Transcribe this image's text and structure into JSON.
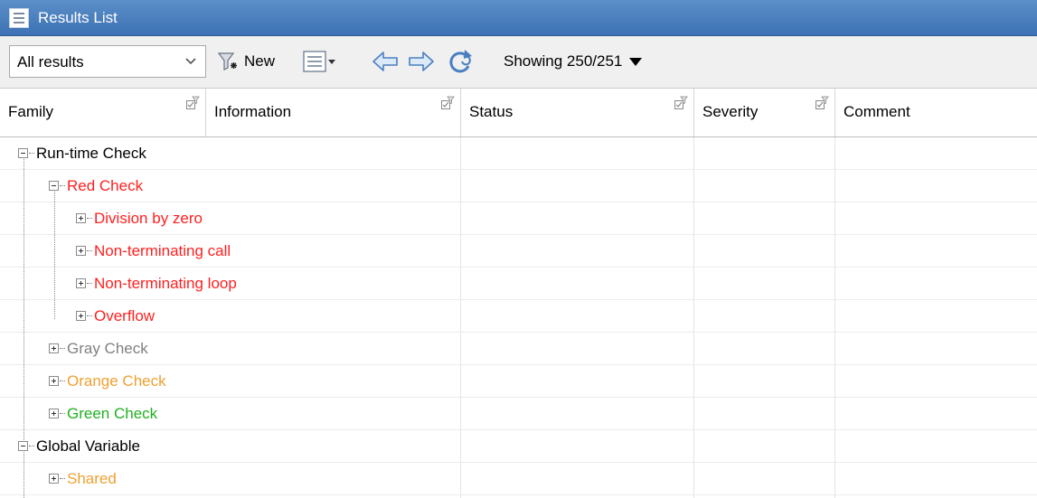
{
  "window": {
    "title": "Results List"
  },
  "toolbar": {
    "filter_select": "All results",
    "new_label": "New",
    "showing": "Showing 250/251"
  },
  "columns": [
    "Family",
    "Information",
    "Status",
    "Severity",
    "Comment"
  ],
  "tree": [
    {
      "label": "Run-time Check",
      "color": "#000000",
      "level": 0,
      "expanded": true
    },
    {
      "label": "Red Check",
      "color": "#ff2020",
      "level": 1,
      "expanded": true
    },
    {
      "label": "Division by zero",
      "color": "#ff2020",
      "level": 2,
      "expanded": false
    },
    {
      "label": "Non-terminating call",
      "color": "#ff2020",
      "level": 2,
      "expanded": false
    },
    {
      "label": "Non-terminating loop",
      "color": "#ff2020",
      "level": 2,
      "expanded": false
    },
    {
      "label": "Overflow",
      "color": "#ff2020",
      "level": 2,
      "expanded": false
    },
    {
      "label": "Gray Check",
      "color": "#808080",
      "level": 1,
      "expanded": false
    },
    {
      "label": "Orange Check",
      "color": "#f0a030",
      "level": 1,
      "expanded": false
    },
    {
      "label": "Green Check",
      "color": "#20b020",
      "level": 1,
      "expanded": false
    },
    {
      "label": "Global Variable",
      "color": "#000000",
      "level": 0,
      "expanded": true
    },
    {
      "label": "Shared",
      "color": "#f0a030",
      "level": 1,
      "expanded": false
    }
  ],
  "icons": [
    "list-icon",
    "chevron-down-icon",
    "new-filter-icon",
    "columns-menu-icon",
    "back-arrow-icon",
    "forward-arrow-icon",
    "refresh-icon",
    "filter-icon"
  ]
}
